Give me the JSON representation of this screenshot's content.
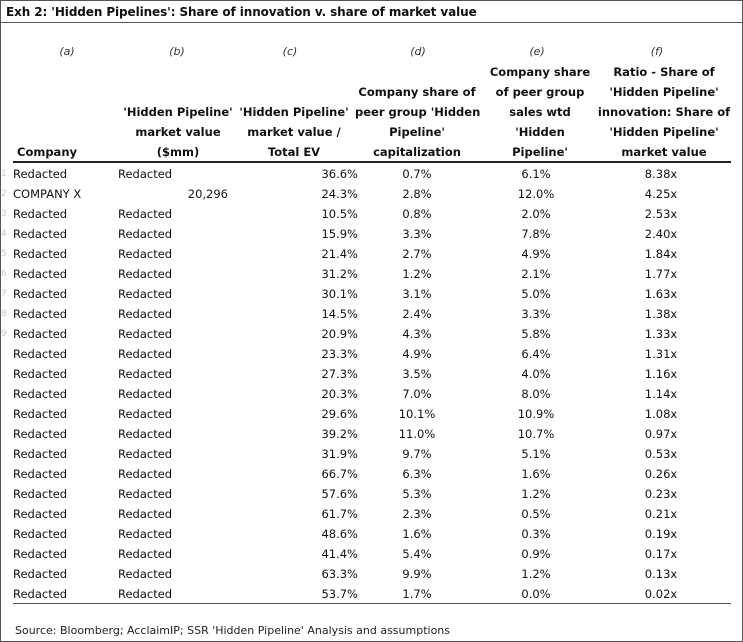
{
  "title": "Exh 2: 'Hidden Pipelines': Share of innovation v. share of market value",
  "column_letters": [
    "(a)",
    "(b)",
    "(c)",
    "(d)",
    "(e)",
    "(f)"
  ],
  "headers": {
    "company": "Company",
    "b": [
      "'Hidden Pipeline'",
      "market value",
      "($mm)"
    ],
    "c": [
      "'Hidden Pipeline'",
      "market value /",
      "Total EV"
    ],
    "d": [
      "Company share of",
      "peer group 'Hidden",
      "Pipeline'",
      "capitalization"
    ],
    "e": [
      "Company share",
      "of peer group",
      "sales wtd",
      "'Hidden",
      "Pipeline'"
    ],
    "f": [
      "Ratio - Share of",
      "'Hidden Pipeline'",
      "innovation: Share of",
      "'Hidden Pipeline'",
      "market value"
    ]
  },
  "rows": [
    {
      "rank": "1",
      "company": "Redacted",
      "mv_label": "Redacted",
      "mv_num": "",
      "c": "36.6%",
      "d": "0.7%",
      "e": "6.1%",
      "f": "8.38x"
    },
    {
      "rank": "2",
      "company": "COMPANY X",
      "mv_label": "",
      "mv_num": "20,296",
      "c": "24.3%",
      "d": "2.8%",
      "e": "12.0%",
      "f": "4.25x"
    },
    {
      "rank": "3",
      "company": "Redacted",
      "mv_label": "Redacted",
      "mv_num": "",
      "c": "10.5%",
      "d": "0.8%",
      "e": "2.0%",
      "f": "2.53x"
    },
    {
      "rank": "4",
      "company": "Redacted",
      "mv_label": "Redacted",
      "mv_num": "",
      "c": "15.9%",
      "d": "3.3%",
      "e": "7.8%",
      "f": "2.40x"
    },
    {
      "rank": "5",
      "company": "Redacted",
      "mv_label": "Redacted",
      "mv_num": "",
      "c": "21.4%",
      "d": "2.7%",
      "e": "4.9%",
      "f": "1.84x"
    },
    {
      "rank": "6",
      "company": "Redacted",
      "mv_label": "Redacted",
      "mv_num": "",
      "c": "31.2%",
      "d": "1.2%",
      "e": "2.1%",
      "f": "1.77x"
    },
    {
      "rank": "7",
      "company": "Redacted",
      "mv_label": "Redacted",
      "mv_num": "",
      "c": "30.1%",
      "d": "3.1%",
      "e": "5.0%",
      "f": "1.63x"
    },
    {
      "rank": "8",
      "company": "Redacted",
      "mv_label": "Redacted",
      "mv_num": "",
      "c": "14.5%",
      "d": "2.4%",
      "e": "3.3%",
      "f": "1.38x"
    },
    {
      "rank": "9",
      "company": "Redacted",
      "mv_label": "Redacted",
      "mv_num": "",
      "c": "20.9%",
      "d": "4.3%",
      "e": "5.8%",
      "f": "1.33x"
    },
    {
      "rank": "",
      "company": "Redacted",
      "mv_label": "Redacted",
      "mv_num": "",
      "c": "23.3%",
      "d": "4.9%",
      "e": "6.4%",
      "f": "1.31x"
    },
    {
      "rank": "",
      "company": "Redacted",
      "mv_label": "Redacted",
      "mv_num": "",
      "c": "27.3%",
      "d": "3.5%",
      "e": "4.0%",
      "f": "1.16x"
    },
    {
      "rank": "",
      "company": "Redacted",
      "mv_label": "Redacted",
      "mv_num": "",
      "c": "20.3%",
      "d": "7.0%",
      "e": "8.0%",
      "f": "1.14x"
    },
    {
      "rank": "",
      "company": "Redacted",
      "mv_label": "Redacted",
      "mv_num": "",
      "c": "29.6%",
      "d": "10.1%",
      "e": "10.9%",
      "f": "1.08x"
    },
    {
      "rank": "",
      "company": "Redacted",
      "mv_label": "Redacted",
      "mv_num": "",
      "c": "39.2%",
      "d": "11.0%",
      "e": "10.7%",
      "f": "0.97x"
    },
    {
      "rank": "",
      "company": "Redacted",
      "mv_label": "Redacted",
      "mv_num": "",
      "c": "31.9%",
      "d": "9.7%",
      "e": "5.1%",
      "f": "0.53x"
    },
    {
      "rank": "",
      "company": "Redacted",
      "mv_label": "Redacted",
      "mv_num": "",
      "c": "66.7%",
      "d": "6.3%",
      "e": "1.6%",
      "f": "0.26x"
    },
    {
      "rank": "",
      "company": "Redacted",
      "mv_label": "Redacted",
      "mv_num": "",
      "c": "57.6%",
      "d": "5.3%",
      "e": "1.2%",
      "f": "0.23x"
    },
    {
      "rank": "",
      "company": "Redacted",
      "mv_label": "Redacted",
      "mv_num": "",
      "c": "61.7%",
      "d": "2.3%",
      "e": "0.5%",
      "f": "0.21x"
    },
    {
      "rank": "",
      "company": "Redacted",
      "mv_label": "Redacted",
      "mv_num": "",
      "c": "48.6%",
      "d": "1.6%",
      "e": "0.3%",
      "f": "0.19x"
    },
    {
      "rank": "",
      "company": "Redacted",
      "mv_label": "Redacted",
      "mv_num": "",
      "c": "41.4%",
      "d": "5.4%",
      "e": "0.9%",
      "f": "0.17x"
    },
    {
      "rank": "",
      "company": "Redacted",
      "mv_label": "Redacted",
      "mv_num": "",
      "c": "63.3%",
      "d": "9.9%",
      "e": "1.2%",
      "f": "0.13x"
    },
    {
      "rank": "",
      "company": "Redacted",
      "mv_label": "Redacted",
      "mv_num": "",
      "c": "53.7%",
      "d": "1.7%",
      "e": "0.0%",
      "f": "0.02x"
    }
  ],
  "source": "Source: Bloomberg; AcclaimIP; SSR 'Hidden Pipeline' Analysis and assumptions"
}
